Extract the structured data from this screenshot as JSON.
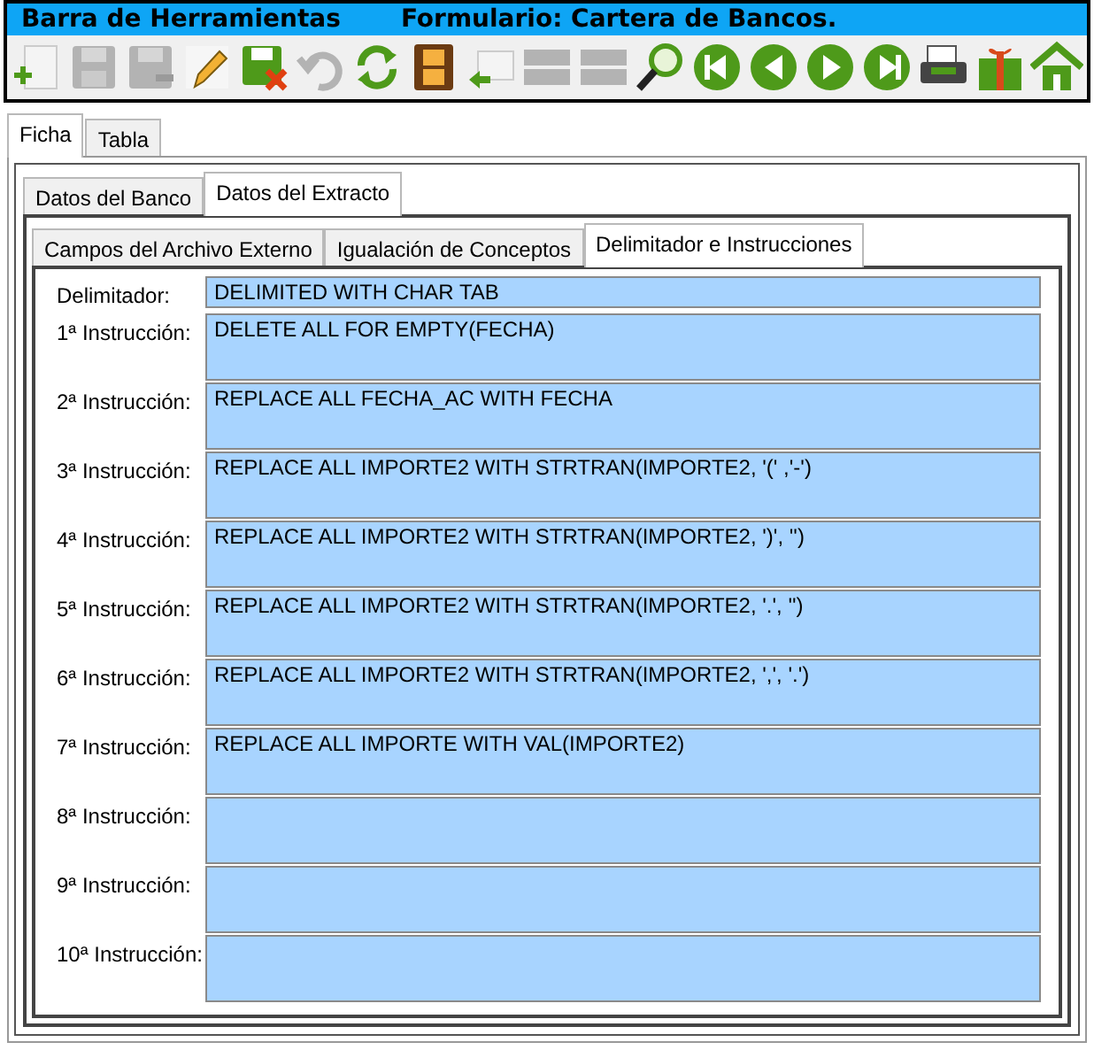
{
  "title_bar": {
    "left": "Barra de Herramientas",
    "right": "Formulario: Cartera de Bancos."
  },
  "toolbar": [
    {
      "kind": "new",
      "disabled": false
    },
    {
      "kind": "save",
      "disabled": true
    },
    {
      "kind": "save-add",
      "disabled": true
    },
    {
      "kind": "pencil",
      "disabled": false
    },
    {
      "kind": "save-cancel",
      "disabled": false
    },
    {
      "kind": "undo",
      "disabled": true
    },
    {
      "kind": "refresh",
      "disabled": false
    },
    {
      "kind": "film",
      "disabled": false
    },
    {
      "kind": "mail",
      "disabled": false
    },
    {
      "kind": "list",
      "disabled": true
    },
    {
      "kind": "list",
      "disabled": true
    },
    {
      "kind": "search",
      "disabled": false
    },
    {
      "kind": "first",
      "disabled": false
    },
    {
      "kind": "prev",
      "disabled": false
    },
    {
      "kind": "next",
      "disabled": false
    },
    {
      "kind": "last",
      "disabled": false
    },
    {
      "kind": "printer",
      "disabled": false
    },
    {
      "kind": "gift",
      "disabled": false
    },
    {
      "kind": "home",
      "disabled": false
    }
  ],
  "tabs": [
    {
      "label": "Ficha",
      "selected": true
    },
    {
      "label": "Tabla",
      "selected": false
    }
  ],
  "subtabs": [
    {
      "label": "Datos del Banco",
      "selected": false
    },
    {
      "label": "Datos del Extracto",
      "selected": true
    }
  ],
  "inner_tabs": [
    {
      "label": "Campos del Archivo Externo",
      "selected": false
    },
    {
      "label": "Igualación de Conceptos",
      "selected": false
    },
    {
      "label": "Delimitador e Instrucciones",
      "selected": true
    }
  ],
  "fields": [
    {
      "label": "Delimitador:",
      "value": "DELIMITED WITH CHAR TAB",
      "kind": "single"
    },
    {
      "label": "1ª Instrucción:",
      "value": "DELETE ALL FOR EMPTY(FECHA)",
      "kind": "multi"
    },
    {
      "label": "2ª Instrucción:",
      "value": "REPLACE ALL FECHA_AC WITH FECHA",
      "kind": "multi"
    },
    {
      "label": "3ª Instrucción:",
      "value": "REPLACE ALL IMPORTE2 WITH STRTRAN(IMPORTE2, '(' ,'-')",
      "kind": "multi"
    },
    {
      "label": "4ª Instrucción:",
      "value": "REPLACE ALL IMPORTE2 WITH STRTRAN(IMPORTE2, ')', '')",
      "kind": "multi"
    },
    {
      "label": "5ª Instrucción:",
      "value": "REPLACE ALL IMPORTE2 WITH STRTRAN(IMPORTE2, '.', '')",
      "kind": "multi"
    },
    {
      "label": "6ª Instrucción:",
      "value": "REPLACE ALL IMPORTE2 WITH STRTRAN(IMPORTE2, ',', '.')",
      "kind": "multi"
    },
    {
      "label": "7ª Instrucción:",
      "value": "REPLACE ALL IMPORTE WITH VAL(IMPORTE2)",
      "kind": "multi"
    },
    {
      "label": "8ª Instrucción:",
      "kind": "multi"
    },
    {
      "label": "9ª Instrucción:",
      "kind": "multi"
    },
    {
      "label": "10ª Instrucción:",
      "kind": "multi"
    }
  ]
}
